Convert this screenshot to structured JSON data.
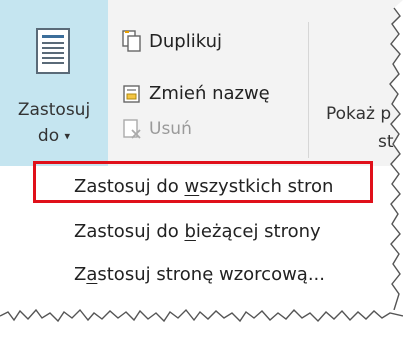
{
  "ribbon": {
    "apply_button": {
      "label_line1": "Zastosuj",
      "label_line2": "do",
      "caret": "▾",
      "icon": "document-lines-icon"
    },
    "commands": [
      {
        "label": "Duplikuj",
        "icon": "duplicate-icon",
        "enabled": true
      },
      {
        "label": "Zmień nazwę",
        "icon": "rename-icon",
        "enabled": true
      },
      {
        "label": "Usuń",
        "icon": "delete-icon",
        "enabled": false
      }
    ],
    "show_button": {
      "label_line1": "Pokaż p",
      "label_line2": "st"
    }
  },
  "menu": {
    "items": [
      {
        "pre": "Zastosuj do ",
        "accel": "w",
        "post": "szystkich stron",
        "highlighted": true
      },
      {
        "pre": "Zastosuj do ",
        "accel": "b",
        "post": "ieżącej strony",
        "highlighted": false
      },
      {
        "pre": "Z",
        "accel": "a",
        "post": "stosuj stronę wzorcową...",
        "highlighted": false
      }
    ]
  },
  "colors": {
    "ribbon_bg": "#f3f3f3",
    "apply_highlight": "#c5e5f0",
    "annotation_red": "#e0101a",
    "disabled_text": "#9a9a9a"
  }
}
